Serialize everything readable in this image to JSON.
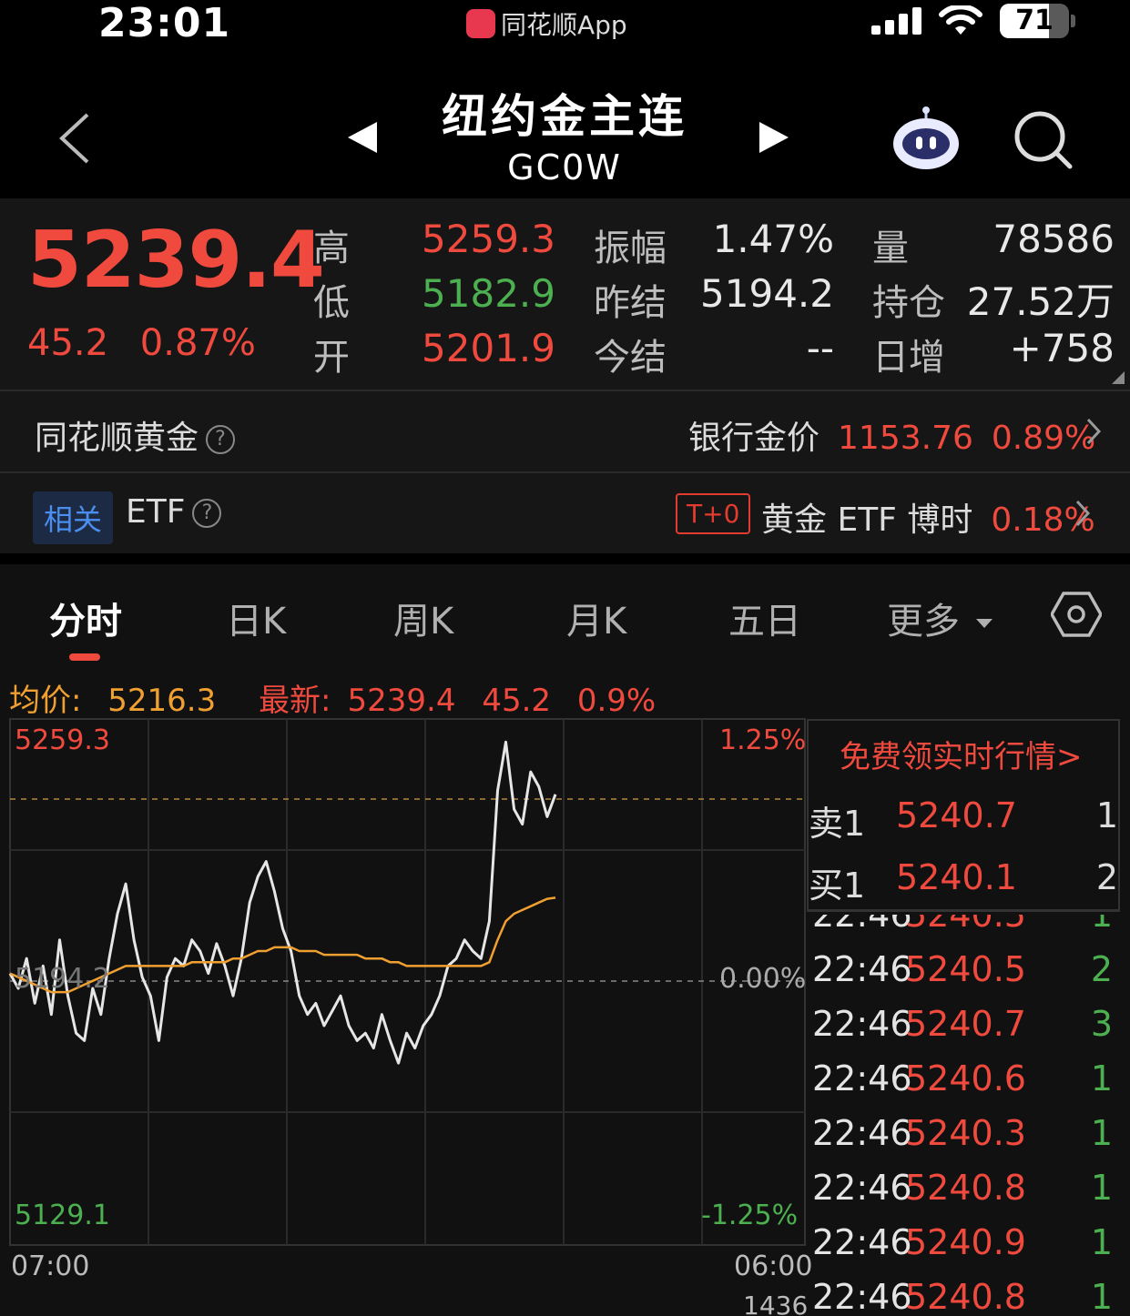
{
  "status_bar": {
    "time": "23:01",
    "app_name": "同花顺App",
    "battery": "71",
    "battery_level": 0.71
  },
  "header": {
    "title": "纽约金主连",
    "code": "GC0W"
  },
  "quote": {
    "last": "5239.4",
    "change": "45.2",
    "change_pct": "0.87%",
    "fields": [
      {
        "label": "高",
        "value": "5259.3",
        "color": "#f04a3e"
      },
      {
        "label": "低",
        "value": "5182.9",
        "color": "#4cb050"
      },
      {
        "label": "开",
        "value": "5201.9",
        "color": "#f04a3e"
      },
      {
        "label": "振幅",
        "value": "1.47%",
        "color": "#e8e8e8"
      },
      {
        "label": "昨结",
        "value": "5194.2",
        "color": "#e8e8e8"
      },
      {
        "label": "今结",
        "value": "--",
        "color": "#e8e8e8"
      },
      {
        "label": "量",
        "value": "78586",
        "color": "#e8e8e8"
      },
      {
        "label": "持仓",
        "value": "27.52万",
        "color": "#e8e8e8"
      },
      {
        "label": "日增",
        "value": "+758",
        "color": "#e8e8e8"
      }
    ]
  },
  "gold_row": {
    "label": "同花顺黄金",
    "help": "?",
    "bank_label": "银行金价",
    "bank_price": "1153.76",
    "bank_pct": "0.89%"
  },
  "etf_row": {
    "tag": "相关",
    "label": "ETF",
    "help": "?",
    "t0": "T+0",
    "text": "黄金 ETF 博时",
    "pct": "0.18%"
  },
  "tabs": [
    {
      "label": "分时"
    },
    {
      "label": "日K"
    },
    {
      "label": "周K"
    },
    {
      "label": "月K"
    },
    {
      "label": "五日"
    },
    {
      "label": "更多"
    }
  ],
  "chart_info": {
    "avg_label": "均价:",
    "avg_value": "5216.3",
    "latest_label": "最新:",
    "latest_value": "5239.4",
    "latest_change": "45.2",
    "latest_pct": "0.9%"
  },
  "chart_data": {
    "type": "line",
    "y_left_ticks": [
      "5259.3",
      "5194.2",
      "5129.1"
    ],
    "y_right_ticks": [
      "1.25%",
      "0.00%",
      "-1.25%"
    ],
    "x_ticks": [
      "07:00",
      "06:00"
    ],
    "ylim": [
      5129.1,
      5259.3
    ],
    "series": [
      {
        "color": "#e6e6e6",
        "values": [
          5196,
          5192,
          5200,
          5188,
          5198,
          5185,
          5205,
          5190,
          5180,
          5178,
          5192,
          5185,
          5200,
          5212,
          5220,
          5205,
          5195,
          5190,
          5178,
          5195,
          5200,
          5198,
          5205,
          5202,
          5196,
          5204,
          5198,
          5190,
          5200,
          5215,
          5222,
          5226,
          5218,
          5208,
          5202,
          5190,
          5185,
          5188,
          5182,
          5186,
          5190,
          5182,
          5178,
          5180,
          5176,
          5185,
          5178,
          5172,
          5180,
          5176,
          5182,
          5185,
          5190,
          5198,
          5200,
          5205,
          5202,
          5200,
          5210,
          5245,
          5258,
          5240,
          5236,
          5250,
          5246,
          5238,
          5244
        ]
      },
      {
        "color": "#f0a030",
        "values": [
          5196,
          5195,
          5194,
          5193,
          5192,
          5191,
          5191,
          5191,
          5192,
          5193,
          5194,
          5195,
          5196,
          5197,
          5198,
          5198,
          5198,
          5198,
          5198,
          5198,
          5198,
          5198,
          5199,
          5199,
          5199,
          5199,
          5199,
          5200,
          5200,
          5201,
          5202,
          5202,
          5203,
          5203,
          5203,
          5202,
          5202,
          5202,
          5201,
          5201,
          5201,
          5201,
          5201,
          5200,
          5200,
          5200,
          5199,
          5199,
          5198,
          5198,
          5198,
          5198,
          5198,
          5198,
          5198,
          5198,
          5198,
          5198,
          5199,
          5205,
          5210,
          5212,
          5213,
          5214,
          5215,
          5216,
          5216.3
        ]
      }
    ]
  },
  "order_book": {
    "free_link": "免费领实时行情>",
    "asks": [
      {
        "label": "卖1",
        "price": "5240.7",
        "qty": "1"
      }
    ],
    "bids": [
      {
        "label": "买1",
        "price": "5240.1",
        "qty": "2"
      }
    ]
  },
  "ticks": [
    {
      "time": "22:46",
      "price": "5240.5",
      "qty": "1"
    },
    {
      "time": "22:46",
      "price": "5240.5",
      "qty": "2"
    },
    {
      "time": "22:46",
      "price": "5240.7",
      "qty": "3"
    },
    {
      "time": "22:46",
      "price": "5240.6",
      "qty": "1"
    },
    {
      "time": "22:46",
      "price": "5240.3",
      "qty": "1"
    },
    {
      "time": "22:46",
      "price": "5240.8",
      "qty": "1"
    },
    {
      "time": "22:46",
      "price": "5240.9",
      "qty": "1"
    },
    {
      "time": "22:46",
      "price": "5240.8",
      "qty": "1"
    }
  ],
  "volume_strip": {
    "value": "1436"
  }
}
